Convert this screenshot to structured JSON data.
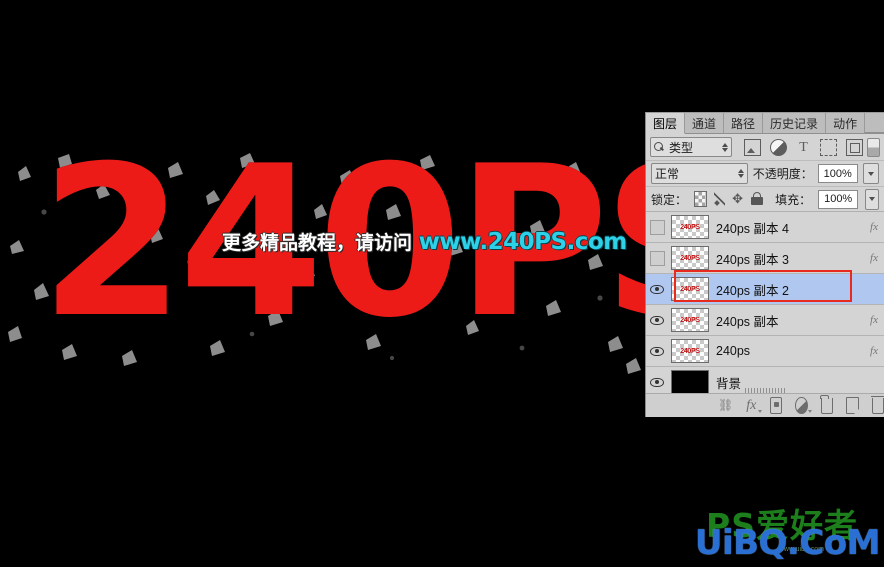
{
  "artwork": {
    "main_text": "240PS",
    "text_color": "#ED1B18",
    "background_color": "#000000",
    "style": "grunge shattered red text on black"
  },
  "overlay": {
    "chinese_text": "更多精品教程，请访问 ",
    "url_text": "www.240PS.com",
    "chinese_color": "#FFFFFF",
    "url_color": "#2ED2E8"
  },
  "watermark": {
    "green_logo": "PS爱好者",
    "blue_text": "UiBQ.CoM",
    "tiny_text": "www.uibq.com",
    "green_color": "#1F8A1F",
    "blue_color": "#2A6FD4"
  },
  "panel": {
    "tabs": [
      {
        "label": "图层",
        "active": true
      },
      {
        "label": "通道",
        "active": false
      },
      {
        "label": "路径",
        "active": false
      },
      {
        "label": "历史记录",
        "active": false
      },
      {
        "label": "动作",
        "active": false
      }
    ],
    "filter_row": {
      "search_icon": "magnifier-icon",
      "kind_label": "类型",
      "icons": [
        {
          "name": "filter-pixel-icon",
          "glyph": "image"
        },
        {
          "name": "filter-adjustment-icon",
          "glyph": "adjust"
        },
        {
          "name": "filter-type-icon",
          "glyph": "T"
        },
        {
          "name": "filter-shape-icon",
          "glyph": "shape"
        },
        {
          "name": "filter-smartobject-icon",
          "glyph": "smart"
        }
      ]
    },
    "blend_row": {
      "blend_mode": "正常",
      "opacity_label": "不透明度：",
      "opacity_value": "100%"
    },
    "lock_row": {
      "lock_label": "锁定：",
      "lock_icons": [
        "lock-transparency-icon",
        "lock-image-icon",
        "lock-position-icon",
        "lock-all-icon"
      ],
      "fill_label": "填充：",
      "fill_value": "100%"
    },
    "layers": [
      {
        "name": "240ps 副本 4",
        "visible": false,
        "selected": false,
        "has_fx": true,
        "thumb_label": "240PS",
        "thumb_kind": "art"
      },
      {
        "name": "240ps 副本 3",
        "visible": false,
        "selected": false,
        "has_fx": true,
        "thumb_label": "240PS",
        "thumb_kind": "art"
      },
      {
        "name": "240ps 副本 2",
        "visible": true,
        "selected": true,
        "has_fx": false,
        "thumb_label": "240PS",
        "thumb_kind": "art"
      },
      {
        "name": "240ps 副本",
        "visible": true,
        "selected": false,
        "has_fx": true,
        "thumb_label": "240PS",
        "thumb_kind": "art"
      },
      {
        "name": "240ps",
        "visible": true,
        "selected": false,
        "has_fx": true,
        "thumb_label": "240PS",
        "thumb_kind": "art"
      },
      {
        "name": "背景",
        "visible": true,
        "selected": false,
        "has_fx": false,
        "thumb_label": "",
        "thumb_kind": "black"
      }
    ],
    "footer_buttons": [
      "link-layers-button",
      "layer-style-fx-button",
      "add-mask-button",
      "new-adjustment-layer-button",
      "new-group-button",
      "new-layer-button",
      "delete-layer-button"
    ],
    "fx_mark": "fx",
    "selection_highlight_color": "#B0C7F0",
    "annotation_color": "#E8291E"
  }
}
